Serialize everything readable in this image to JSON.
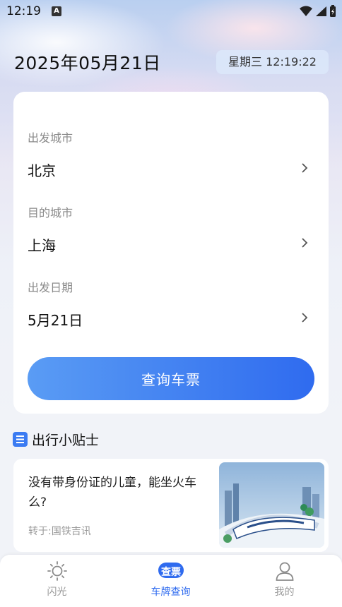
{
  "status_bar": {
    "time": "12:19",
    "notification_letter": "A"
  },
  "header": {
    "date": "2025年05月21日",
    "weekday_time": "星期三 12:19:22"
  },
  "search_form": {
    "departure": {
      "label": "出发城市",
      "value": "北京"
    },
    "destination": {
      "label": "目的城市",
      "value": "上海"
    },
    "date": {
      "label": "出发日期",
      "value": "5月21日"
    },
    "submit_label": "查询车票"
  },
  "tips": {
    "section_title": "出行小贴士",
    "article": {
      "title": "没有带身份证的儿童，能坐火车么?",
      "source": "转于:国铁吉讯"
    }
  },
  "tabbar": {
    "items": [
      {
        "label": "闪光",
        "icon": "sun-icon"
      },
      {
        "label": "车牌查询",
        "icon": "query-ticket-icon",
        "icon_text": "查票",
        "active": true
      },
      {
        "label": "我的",
        "icon": "user-icon"
      }
    ]
  },
  "colors": {
    "accent": "#2f6bef",
    "accent_light": "#5a9cf4"
  }
}
